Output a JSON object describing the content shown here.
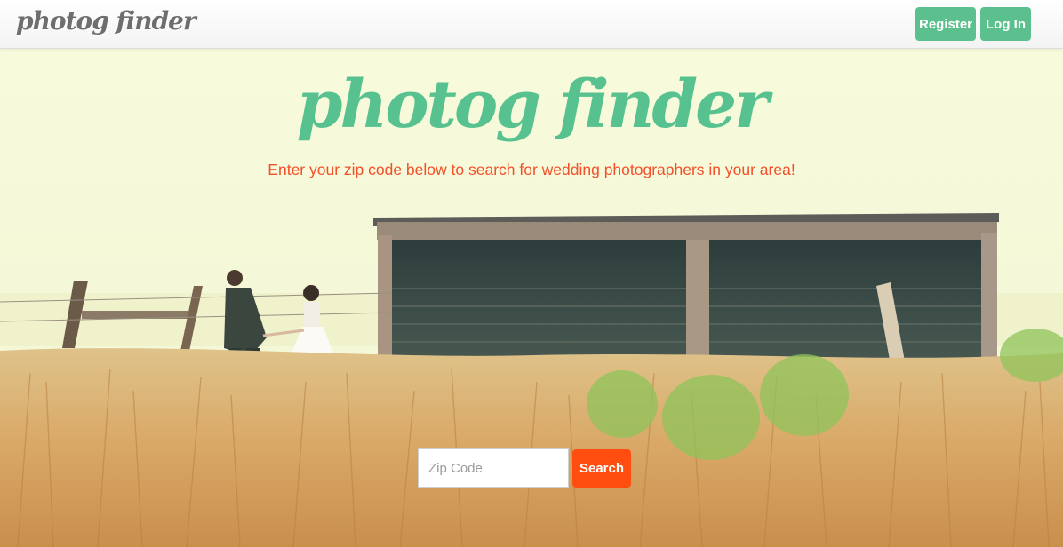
{
  "navbar": {
    "brand": "photog finder",
    "register_label": "Register",
    "login_label": "Log In"
  },
  "hero": {
    "title": "photog finder",
    "subtitle": "Enter your zip code below to search for wedding photographers in your area!"
  },
  "search": {
    "zip_placeholder": "Zip Code",
    "zip_value": "",
    "button_label": "Search"
  },
  "colors": {
    "accent_green": "#5cc08e",
    "accent_orange": "#ff4e10",
    "subtitle_orange": "#f2502a"
  }
}
